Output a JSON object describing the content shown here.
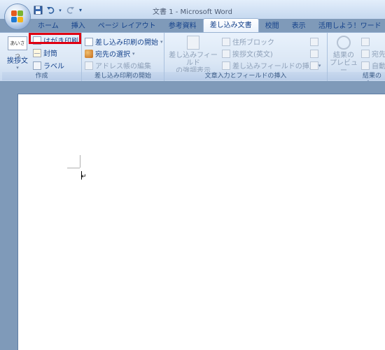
{
  "window": {
    "title": "文書 1 - Microsoft Word"
  },
  "quick_access": {
    "items": [
      "save-icon",
      "undo-icon",
      "redo-icon",
      "customize-icon"
    ]
  },
  "tabs": [
    "ホーム",
    "挿入",
    "ページ レイアウト",
    "参考資料",
    "差し込み文書",
    "校閲",
    "表示",
    "活用しよう！ワード"
  ],
  "active_tab": "差し込み文書",
  "ribbon": {
    "create": {
      "label": "作成",
      "greeting": "挨拶文",
      "greeting_icon_text": "あいさつ",
      "postcard": "はがき印刷",
      "envelope": "封筒",
      "labels": "ラベル"
    },
    "start_merge": {
      "label": "差し込み印刷の開始",
      "start": "差し込み印刷の開始",
      "select_recipients": "宛先の選択",
      "edit_list": "アドレス帳の編集"
    },
    "write_insert": {
      "label": "文章入力とフィールドの挿入",
      "highlight_line1": "差し込みフィールド",
      "highlight_line2": "の強調表示",
      "address_block": "住所ブロック",
      "greeting_line": "挨拶文(英文)",
      "insert_field": "差し込みフィールドの挿入"
    },
    "preview": {
      "label": "結果のプ",
      "preview_line1": "結果の",
      "preview_line2": "プレビュー",
      "recipient": "宛先",
      "auto": "自動"
    }
  },
  "colors": {
    "highlight_border": "#e00012",
    "ribbon_text": "#15428b",
    "workspace": "#7f9ab9"
  }
}
